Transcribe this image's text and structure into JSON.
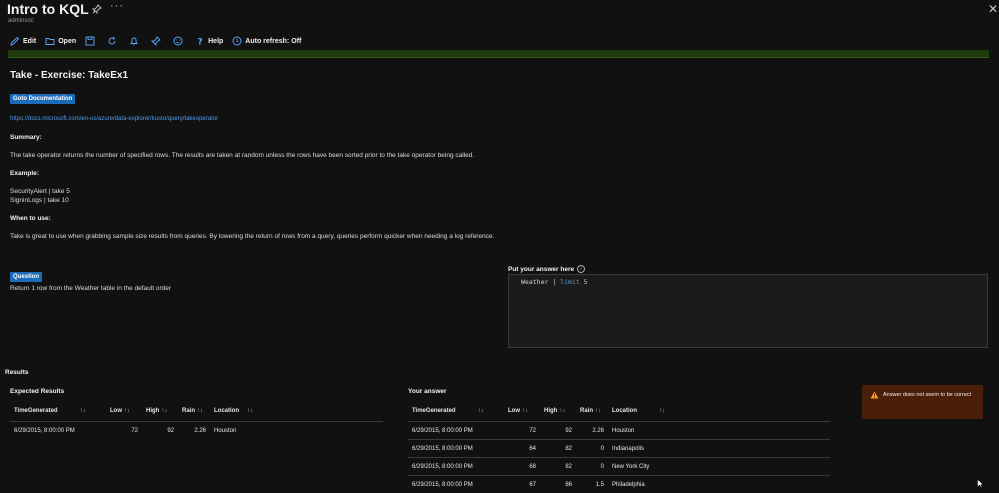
{
  "header": {
    "title": "Intro to KQL",
    "subtitle": "adminsoc",
    "more": "···",
    "close": "✕"
  },
  "toolbar": {
    "edit": "Edit",
    "open": "Open",
    "help": "Help",
    "auto_refresh": "Auto refresh: Off"
  },
  "exercise": {
    "heading": "Take - Exercise: TakeEx1",
    "doc_button": "Goto Documentation",
    "doc_link": "https://docs.microsoft.com/en-us/azure/data-explorer/kusto/query/takeoperator",
    "summary_label": "Summary:",
    "summary_text": "The take operator returns the number of specified rows. The results are taken at random unless the rows have been sorted prior to the take operator being called.",
    "example_label": "Example:",
    "example_lines": [
      "SecurityAlert | take 5",
      "SigninLogs | take 10"
    ],
    "when_label": "When to use:",
    "when_text": "Take is great to use when grabbing sample size results from queries. By lowering the return of rows from a query, queries perform quicker when needing a log reference."
  },
  "question": {
    "button": "Question",
    "text": "Return 1 row from the Weather table in the default order"
  },
  "answer": {
    "label": "Put your answer here",
    "info": "i",
    "code_table": "Weather",
    "code_pipe": "|",
    "code_keyword": "limit",
    "code_value": "5"
  },
  "results": {
    "title": "Results",
    "expected_title": "Expected Results",
    "yours_title": "Your answer",
    "columns": [
      "TimeGenerated",
      "Low",
      "High",
      "Rain",
      "Location"
    ],
    "expected_rows": [
      [
        "6/29/2015, 8:00:00 PM",
        "72",
        "92",
        "2.26",
        "Houston"
      ]
    ],
    "your_rows": [
      [
        "6/29/2015, 8:00:00 PM",
        "72",
        "92",
        "2.26",
        "Houston"
      ],
      [
        "6/29/2015, 8:00:00 PM",
        "64",
        "82",
        "0",
        "Indianapolis"
      ],
      [
        "6/29/2015, 8:00:00 PM",
        "68",
        "82",
        "0",
        "New York City"
      ],
      [
        "6/29/2015, 8:00:00 PM",
        "67",
        "86",
        "1.5",
        "Philadelphia"
      ]
    ]
  },
  "toast": {
    "message": "Answer does not seem to be correct"
  },
  "colors": {
    "accent_blue": "#1a6bb8",
    "link_blue": "#4f9cf0",
    "progress_green": "#1e3a0c",
    "toast_bg": "#4a1f0a",
    "warn_orange": "#f59a23"
  }
}
